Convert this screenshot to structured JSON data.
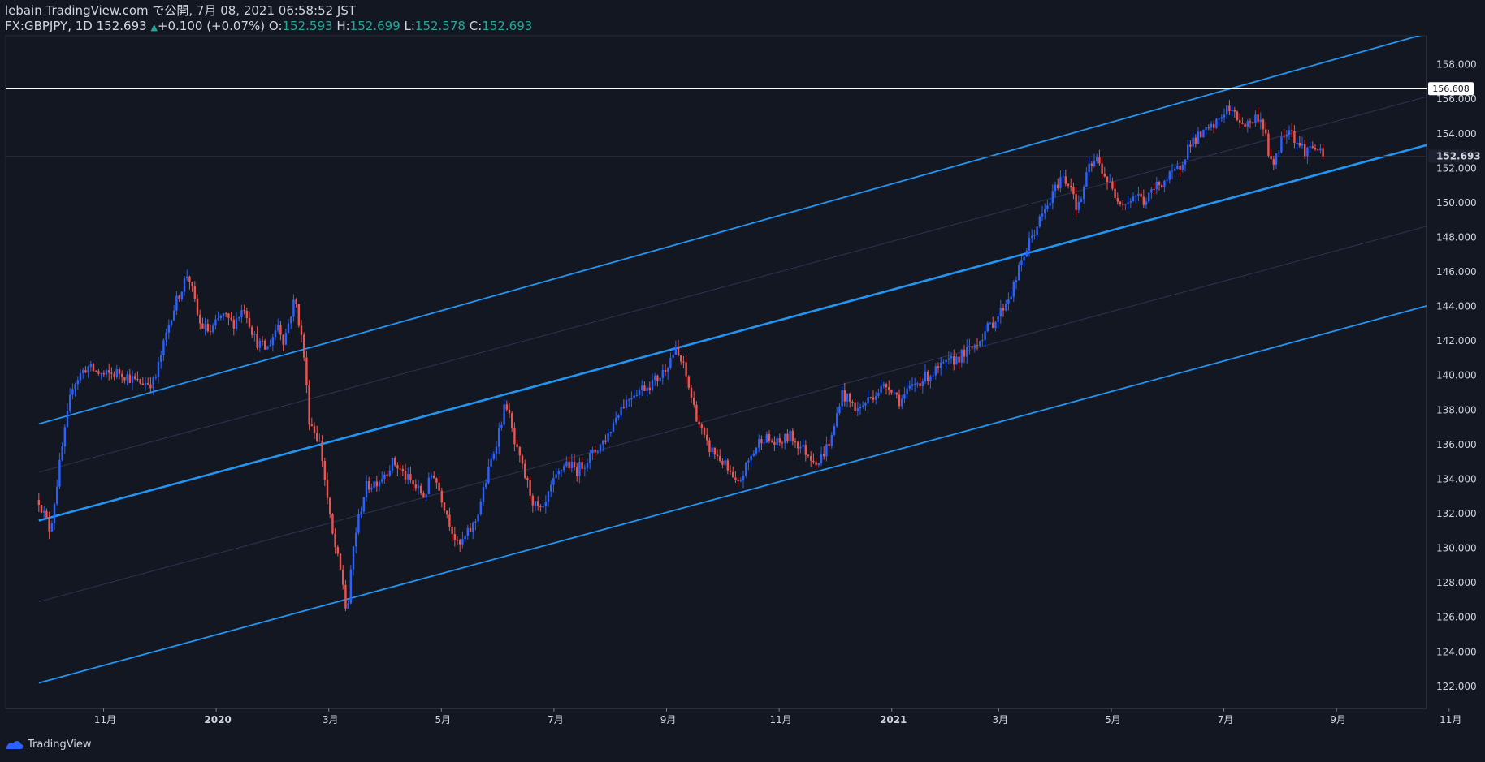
{
  "header": {
    "published": "lebain TradingView.com で公開, 7月 08, 2021 06:58:52 JST",
    "symbol": "FX:GBPJPY, 1D",
    "last": "152.693",
    "change": "+0.100 (+0.07%)",
    "o_label": "O:",
    "o_value": "152.593",
    "h_label": "H:",
    "h_value": "152.699",
    "l_label": "L:",
    "l_value": "152.578",
    "c_label": "C:",
    "c_value": "152.693"
  },
  "footer": {
    "brand": "TradingView"
  },
  "colors": {
    "background": "#131722",
    "up": "#2962ff",
    "down": "#ef5350",
    "channel": "#2196f3",
    "hline": "#ffffff",
    "axis_text": "#d1d4dc"
  },
  "chart_data": {
    "type": "candlestick",
    "symbol": "GBPJPY",
    "interval": "1D",
    "ylim": [
      121,
      160
    ],
    "y_ticks": [
      122,
      124,
      126,
      128,
      130,
      132,
      134,
      136,
      138,
      140,
      142,
      144,
      146,
      148,
      150,
      152,
      154,
      156,
      158
    ],
    "x_ticks": [
      {
        "label": "11月",
        "t": 0.7,
        "bold": false
      },
      {
        "label": "2020",
        "t": 2.7,
        "bold": true
      },
      {
        "label": "3月",
        "t": 4.7,
        "bold": false
      },
      {
        "label": "5月",
        "t": 6.7,
        "bold": false
      },
      {
        "label": "7月",
        "t": 8.7,
        "bold": false
      },
      {
        "label": "9月",
        "t": 10.7,
        "bold": false
      },
      {
        "label": "11月",
        "t": 12.7,
        "bold": false
      },
      {
        "label": "2021",
        "t": 14.7,
        "bold": true
      },
      {
        "label": "3月",
        "t": 16.6,
        "bold": false
      },
      {
        "label": "5月",
        "t": 18.6,
        "bold": false
      },
      {
        "label": "7月",
        "t": 20.6,
        "bold": false
      },
      {
        "label": "9月",
        "t": 22.6,
        "bold": false
      },
      {
        "label": "11月",
        "t": 24.6,
        "bold": false
      }
    ],
    "price_path": [
      [
        -0.45,
        132.8
      ],
      [
        -0.25,
        131.0
      ],
      [
        -0.05,
        135.5
      ],
      [
        0.15,
        139.5
      ],
      [
        0.4,
        140.5
      ],
      [
        0.7,
        140.0
      ],
      [
        1.0,
        140.2
      ],
      [
        1.3,
        139.6
      ],
      [
        1.6,
        139.6
      ],
      [
        1.9,
        143.5
      ],
      [
        2.2,
        146.0
      ],
      [
        2.4,
        143.0
      ],
      [
        2.6,
        142.5
      ],
      [
        2.8,
        143.5
      ],
      [
        3.0,
        143.0
      ],
      [
        3.2,
        144.0
      ],
      [
        3.4,
        142.0
      ],
      [
        3.6,
        141.5
      ],
      [
        3.8,
        143.0
      ],
      [
        3.9,
        142.0
      ],
      [
        4.1,
        144.5
      ],
      [
        4.25,
        141.5
      ],
      [
        4.35,
        137.5
      ],
      [
        4.55,
        136.0
      ],
      [
        4.75,
        131.0
      ],
      [
        4.95,
        128.0
      ],
      [
        5.02,
        126.0
      ],
      [
        5.15,
        130.5
      ],
      [
        5.35,
        133.5
      ],
      [
        5.6,
        134.0
      ],
      [
        5.85,
        135.0
      ],
      [
        6.1,
        134.0
      ],
      [
        6.4,
        133.0
      ],
      [
        6.55,
        134.5
      ],
      [
        6.8,
        132.0
      ],
      [
        7.0,
        130.0
      ],
      [
        7.3,
        131.5
      ],
      [
        7.5,
        134.0
      ],
      [
        7.7,
        136.5
      ],
      [
        7.85,
        138.5
      ],
      [
        8.0,
        136.0
      ],
      [
        8.2,
        134.0
      ],
      [
        8.35,
        132.5
      ],
      [
        8.5,
        132.0
      ],
      [
        8.65,
        133.5
      ],
      [
        8.9,
        135.0
      ],
      [
        9.1,
        134.5
      ],
      [
        9.4,
        135.5
      ],
      [
        9.65,
        136.5
      ],
      [
        9.85,
        138.0
      ],
      [
        10.1,
        139.0
      ],
      [
        10.4,
        139.5
      ],
      [
        10.6,
        140.0
      ],
      [
        10.85,
        141.5
      ],
      [
        11.0,
        140.5
      ],
      [
        11.2,
        138.0
      ],
      [
        11.4,
        136.0
      ],
      [
        11.7,
        135.0
      ],
      [
        11.95,
        133.5
      ],
      [
        12.15,
        135.0
      ],
      [
        12.4,
        136.5
      ],
      [
        12.65,
        136.0
      ],
      [
        12.9,
        136.5
      ],
      [
        13.2,
        135.5
      ],
      [
        13.4,
        135.0
      ],
      [
        13.65,
        136.5
      ],
      [
        13.8,
        139.0
      ],
      [
        14.1,
        138.0
      ],
      [
        14.4,
        139.0
      ],
      [
        14.65,
        139.5
      ],
      [
        14.85,
        138.5
      ],
      [
        15.1,
        139.5
      ],
      [
        15.35,
        140.0
      ],
      [
        15.6,
        140.5
      ],
      [
        15.85,
        141.0
      ],
      [
        16.1,
        141.5
      ],
      [
        16.35,
        142.5
      ],
      [
        16.6,
        143.5
      ],
      [
        16.85,
        145.0
      ],
      [
        17.05,
        147.0
      ],
      [
        17.25,
        148.5
      ],
      [
        17.5,
        150.0
      ],
      [
        17.7,
        151.5
      ],
      [
        17.9,
        151.0
      ],
      [
        18.0,
        149.5
      ],
      [
        18.2,
        152.0
      ],
      [
        18.35,
        152.5
      ],
      [
        18.5,
        151.5
      ],
      [
        18.65,
        150.5
      ],
      [
        18.85,
        150.0
      ],
      [
        19.05,
        150.5
      ],
      [
        19.2,
        150.0
      ],
      [
        19.4,
        151.0
      ],
      [
        19.65,
        151.5
      ],
      [
        19.8,
        152.0
      ],
      [
        20.0,
        153.5
      ],
      [
        20.25,
        154.0
      ],
      [
        20.45,
        154.5
      ],
      [
        20.65,
        155.5
      ],
      [
        20.8,
        155.0
      ],
      [
        21.0,
        154.5
      ],
      [
        21.2,
        155.0
      ],
      [
        21.3,
        154.5
      ],
      [
        21.45,
        152.0
      ],
      [
        21.6,
        153.5
      ],
      [
        21.75,
        154.5
      ],
      [
        21.9,
        153.5
      ],
      [
        22.05,
        153.0
      ],
      [
        22.2,
        153.3
      ],
      [
        22.35,
        152.69
      ]
    ],
    "lines": [
      {
        "kind": "horizontal",
        "y": 156.608,
        "label": "156.608"
      },
      {
        "kind": "channel-upper",
        "from": [
          -0.45,
          137.2
        ],
        "to": [
          24.2,
          159.8
        ]
      },
      {
        "kind": "channel-middle",
        "from": [
          -0.45,
          131.6
        ],
        "to": [
          26.65,
          155.5
        ]
      },
      {
        "kind": "channel-lower",
        "from": [
          -0.45,
          122.2
        ],
        "to": [
          26.65,
          146.2
        ]
      },
      {
        "kind": "faint",
        "from": [
          -0.45,
          134.4
        ],
        "to": [
          26.65,
          158.3
        ]
      },
      {
        "kind": "faint",
        "from": [
          -0.45,
          126.9
        ],
        "to": [
          26.65,
          150.8
        ]
      }
    ],
    "last_price": 152.693,
    "last_price_label": "152.693",
    "hline_label": "156.608"
  }
}
